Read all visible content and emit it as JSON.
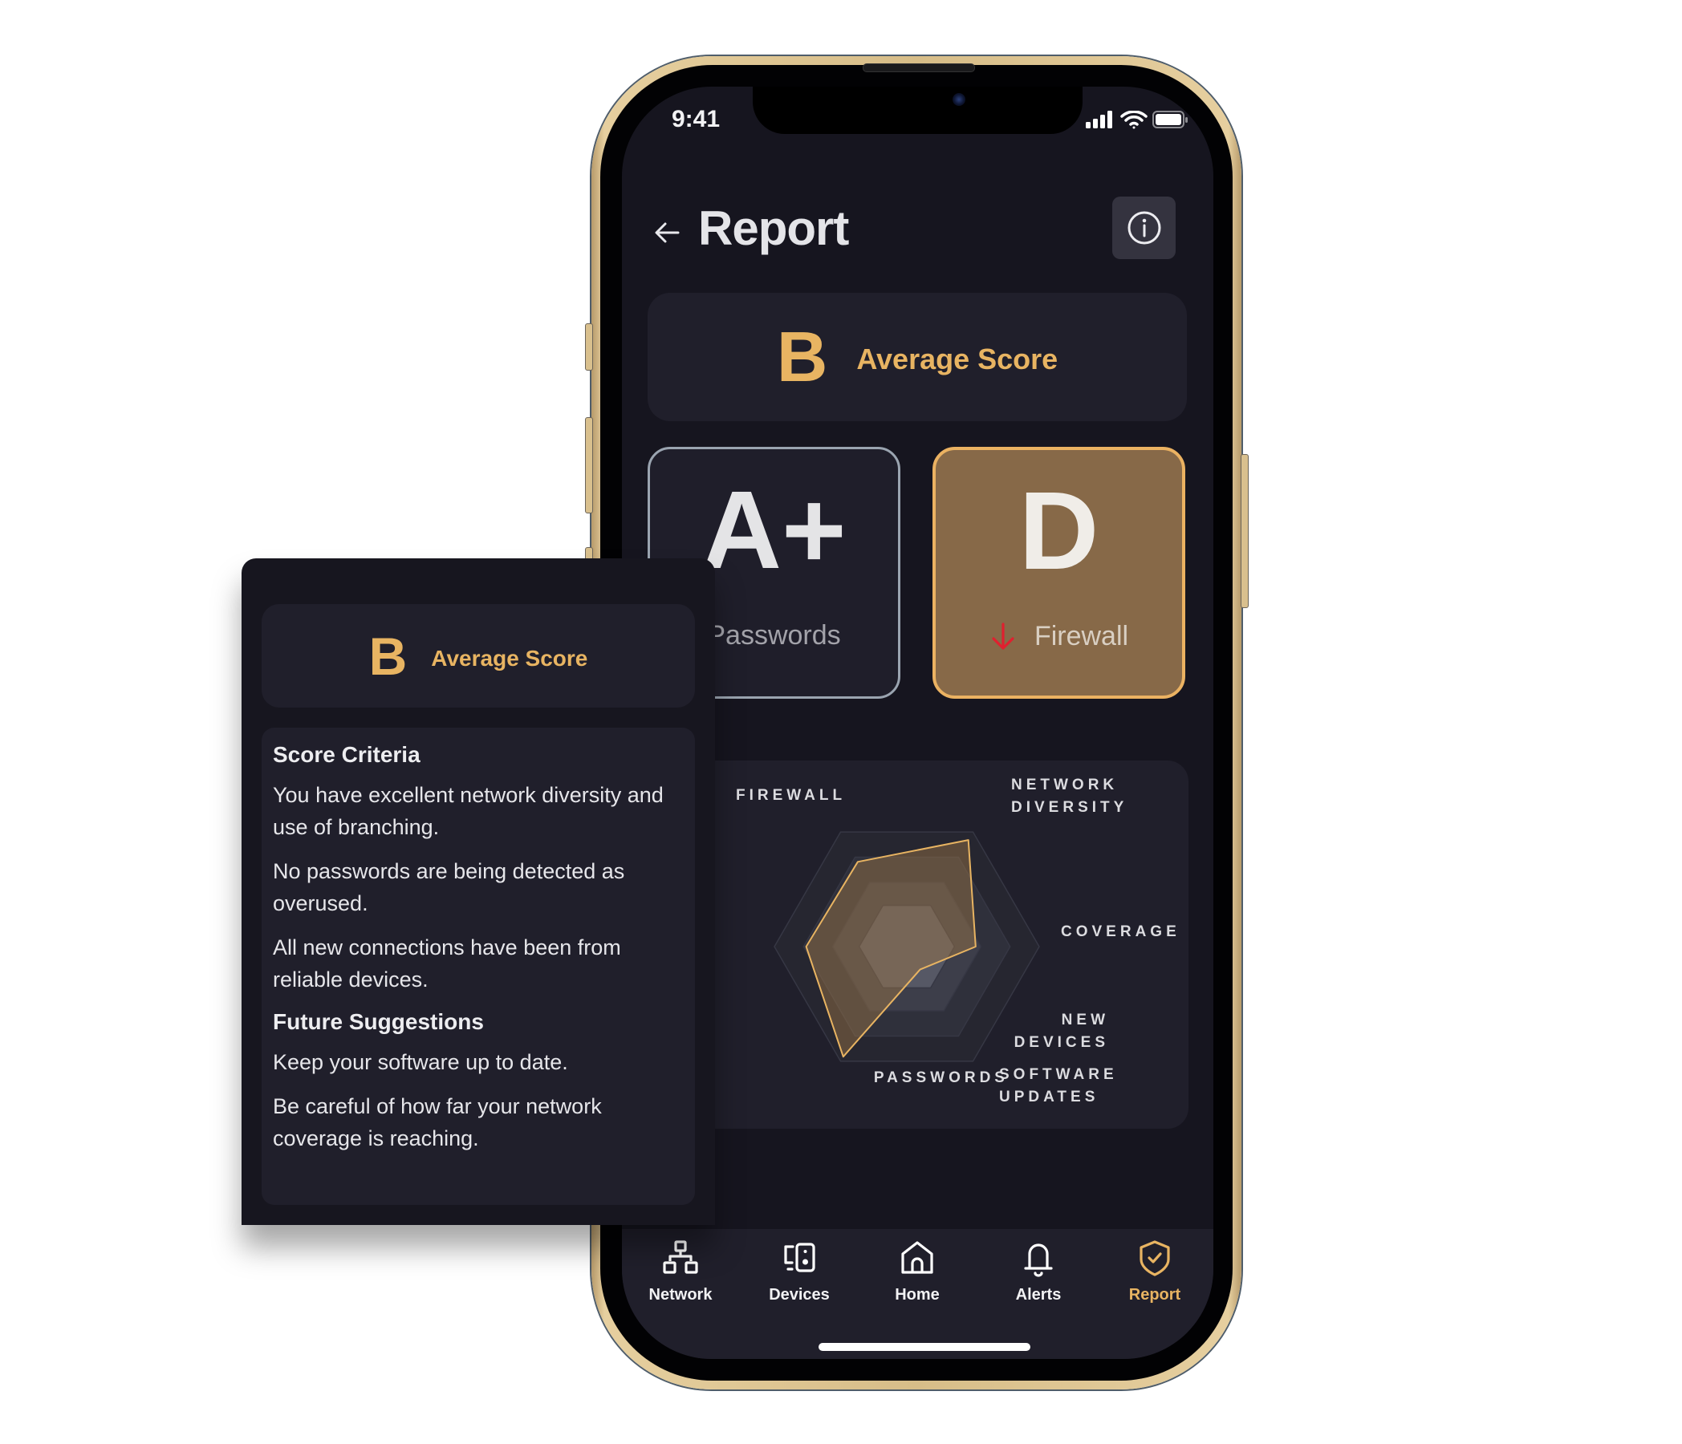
{
  "status_bar": {
    "time": "9:41",
    "icons": [
      "signal-icon",
      "wifi-icon",
      "battery-icon"
    ]
  },
  "header": {
    "back_icon": "arrow-left-icon",
    "title": "Report",
    "info_icon": "info-circle-icon"
  },
  "average_score": {
    "grade": "B",
    "label": "Average Score"
  },
  "grade_cards": [
    {
      "grade": "A+",
      "category": "Passwords",
      "trend": null
    },
    {
      "grade": "D",
      "category": "Firewall",
      "trend": "down",
      "trend_icon": "arrow-down-icon"
    }
  ],
  "colors": {
    "accent": "#E8B462",
    "screen_bg": "#16151F",
    "card_bg": "#201F2B",
    "bad_card_bg": "#876948",
    "good_card_border": "#9AA4B0",
    "trend_down": "#E02030"
  },
  "chart_data": {
    "type": "radar",
    "title": "",
    "axes": [
      "Network Diversity",
      "Coverage",
      "Software Updates",
      "Passwords",
      "New Devices",
      "Firewall"
    ],
    "axis_labels": [
      "NETWORK\nDIVERSITY",
      "COVERAGE",
      "SOFTWARE\nUPDATES",
      "PASSWORDS",
      "NEW\nDEVICES",
      "FIREWALL"
    ],
    "values": [
      0.93,
      0.52,
      0.2,
      0.96,
      0.76,
      0.74
    ],
    "range": [
      0,
      1
    ],
    "ring_levels": [
      1.0,
      0.78,
      0.56,
      0.36
    ],
    "series_color": "#E8B462"
  },
  "tab_bar": {
    "tabs": [
      {
        "label": "Network",
        "icon": "network-icon",
        "active": false
      },
      {
        "label": "Devices",
        "icon": "devices-icon",
        "active": false
      },
      {
        "label": "Home",
        "icon": "home-icon",
        "active": false
      },
      {
        "label": "Alerts",
        "icon": "bell-icon",
        "active": false
      },
      {
        "label": "Report",
        "icon": "shield-check-icon",
        "active": true
      }
    ]
  },
  "popup": {
    "average_score": {
      "grade": "B",
      "label": "Average Score"
    },
    "criteria_heading": "Score Criteria",
    "criteria": [
      "You have excellent network diversity and use of branching.",
      "No passwords are being detected as overused.",
      "All new connections have been from reliable devices."
    ],
    "suggestions_heading": "Future Suggestions",
    "suggestions": [
      "Keep your software up to date.",
      "Be careful of how far your network coverage is reaching."
    ]
  }
}
